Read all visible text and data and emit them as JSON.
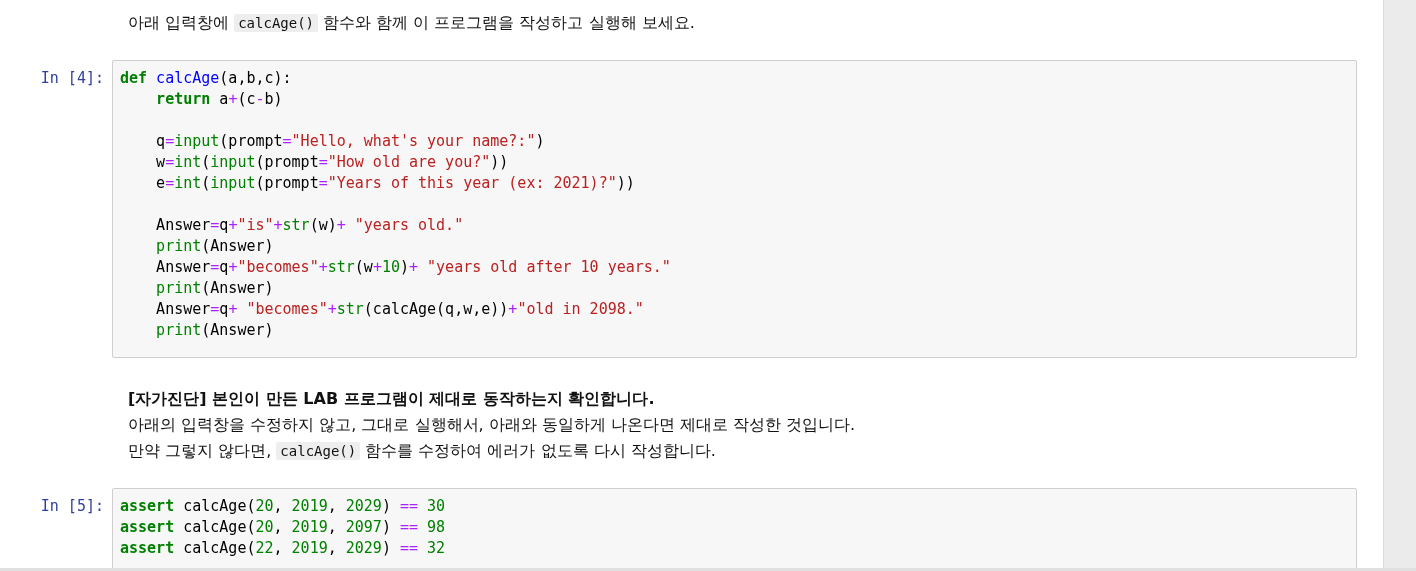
{
  "cells": [
    {
      "kind": "markdown",
      "paragraphs": [
        [
          {
            "kind": "text",
            "text": "아래 입력창에 "
          },
          {
            "kind": "code",
            "text": "calcAge()"
          },
          {
            "kind": "text",
            "text": " 함수와 함께 이 프로그램을 작성하고 실행해 보세요."
          }
        ]
      ]
    },
    {
      "kind": "code",
      "prompt": "In [4]:",
      "blocks": [
        [
          [
            {
              "kind": "kw",
              "text": "def"
            },
            {
              "kind": "fn",
              "text": " calcAge"
            },
            {
              "kind": "plain",
              "text": "(a,b,c):"
            }
          ],
          [
            {
              "kind": "kw",
              "text": "    return"
            },
            {
              "kind": "plain",
              "text": " a"
            },
            {
              "kind": "op",
              "text": "+"
            },
            {
              "kind": "plain",
              "text": "(c"
            },
            {
              "kind": "op",
              "text": "-"
            },
            {
              "kind": "plain",
              "text": "b)"
            }
          ]
        ],
        [
          [
            {
              "kind": "plain",
              "text": "    q"
            },
            {
              "kind": "op",
              "text": "="
            },
            {
              "kind": "builtin",
              "text": "input"
            },
            {
              "kind": "plain",
              "text": "(prompt"
            },
            {
              "kind": "op",
              "text": "="
            },
            {
              "kind": "str",
              "text": "\"Hello, what's your name?:\""
            },
            {
              "kind": "plain",
              "text": ")"
            }
          ],
          [
            {
              "kind": "plain",
              "text": "    w"
            },
            {
              "kind": "op",
              "text": "="
            },
            {
              "kind": "builtin",
              "text": "int"
            },
            {
              "kind": "plain",
              "text": "("
            },
            {
              "kind": "builtin",
              "text": "input"
            },
            {
              "kind": "plain",
              "text": "(prompt"
            },
            {
              "kind": "op",
              "text": "="
            },
            {
              "kind": "str",
              "text": "\"How old are you?\""
            },
            {
              "kind": "plain",
              "text": "))"
            }
          ],
          [
            {
              "kind": "plain",
              "text": "    e"
            },
            {
              "kind": "op",
              "text": "="
            },
            {
              "kind": "builtin",
              "text": "int"
            },
            {
              "kind": "plain",
              "text": "("
            },
            {
              "kind": "builtin",
              "text": "input"
            },
            {
              "kind": "plain",
              "text": "(prompt"
            },
            {
              "kind": "op",
              "text": "="
            },
            {
              "kind": "str",
              "text": "\"Years of this year (ex: 2021)?\""
            },
            {
              "kind": "plain",
              "text": "))"
            }
          ]
        ],
        [
          [
            {
              "kind": "plain",
              "text": "    Answer"
            },
            {
              "kind": "op",
              "text": "="
            },
            {
              "kind": "plain",
              "text": "q"
            },
            {
              "kind": "op",
              "text": "+"
            },
            {
              "kind": "str",
              "text": "\"is\""
            },
            {
              "kind": "op",
              "text": "+"
            },
            {
              "kind": "builtin",
              "text": "str"
            },
            {
              "kind": "plain",
              "text": "(w)"
            },
            {
              "kind": "op",
              "text": "+"
            },
            {
              "kind": "str",
              "text": " \"years old.\""
            }
          ],
          [
            {
              "kind": "builtin",
              "text": "    print"
            },
            {
              "kind": "plain",
              "text": "(Answer)"
            }
          ],
          [
            {
              "kind": "plain",
              "text": "    Answer"
            },
            {
              "kind": "op",
              "text": "="
            },
            {
              "kind": "plain",
              "text": "q"
            },
            {
              "kind": "op",
              "text": "+"
            },
            {
              "kind": "str",
              "text": "\"becomes\""
            },
            {
              "kind": "op",
              "text": "+"
            },
            {
              "kind": "builtin",
              "text": "str"
            },
            {
              "kind": "plain",
              "text": "(w"
            },
            {
              "kind": "op",
              "text": "+"
            },
            {
              "kind": "num",
              "text": "10"
            },
            {
              "kind": "plain",
              "text": ")"
            },
            {
              "kind": "op",
              "text": "+"
            },
            {
              "kind": "str",
              "text": " \"years old after 10 years.\""
            }
          ],
          [
            {
              "kind": "builtin",
              "text": "    print"
            },
            {
              "kind": "plain",
              "text": "(Answer)"
            }
          ],
          [
            {
              "kind": "plain",
              "text": "    Answer"
            },
            {
              "kind": "op",
              "text": "="
            },
            {
              "kind": "plain",
              "text": "q"
            },
            {
              "kind": "op",
              "text": "+"
            },
            {
              "kind": "str",
              "text": " \"becomes\""
            },
            {
              "kind": "op",
              "text": "+"
            },
            {
              "kind": "builtin",
              "text": "str"
            },
            {
              "kind": "plain",
              "text": "(calcAge(q,w,e))"
            },
            {
              "kind": "op",
              "text": "+"
            },
            {
              "kind": "str",
              "text": "\"old in 2098.\""
            }
          ],
          [
            {
              "kind": "builtin",
              "text": "    print"
            },
            {
              "kind": "plain",
              "text": "(Answer)"
            }
          ]
        ]
      ]
    },
    {
      "kind": "markdown",
      "paragraphs": [
        [
          {
            "kind": "text",
            "text": "**[자가진단] 본인이 만든 LAB 프로그램이 제대로 동작하는지 확인합니다.**"
          }
        ],
        [
          {
            "kind": "text",
            "text": "아래의 입력창을 수정하지 않고, 그대로 실행해서, 아래와 동일하게 나온다면 제대로 작성한 것입니다."
          }
        ],
        [
          {
            "kind": "text",
            "text": "만약 그렇지 않다면, "
          },
          {
            "kind": "code",
            "text": "calcAge()"
          },
          {
            "kind": "text",
            "text": " 함수를 수정하여 에러가 없도록 다시 작성합니다."
          }
        ]
      ]
    },
    {
      "kind": "code",
      "prompt": "In [5]:",
      "blocks": [
        [
          [
            {
              "kind": "kw",
              "text": "assert"
            },
            {
              "kind": "plain",
              "text": " calcAge("
            },
            {
              "kind": "num",
              "text": "20"
            },
            {
              "kind": "plain",
              "text": ", "
            },
            {
              "kind": "num",
              "text": "2019"
            },
            {
              "kind": "plain",
              "text": ", "
            },
            {
              "kind": "num",
              "text": "2029"
            },
            {
              "kind": "plain",
              "text": ") "
            },
            {
              "kind": "op",
              "text": "=="
            },
            {
              "kind": "num",
              "text": " 30"
            }
          ],
          [
            {
              "kind": "kw",
              "text": "assert"
            },
            {
              "kind": "plain",
              "text": " calcAge("
            },
            {
              "kind": "num",
              "text": "20"
            },
            {
              "kind": "plain",
              "text": ", "
            },
            {
              "kind": "num",
              "text": "2019"
            },
            {
              "kind": "plain",
              "text": ", "
            },
            {
              "kind": "num",
              "text": "2097"
            },
            {
              "kind": "plain",
              "text": ") "
            },
            {
              "kind": "op",
              "text": "=="
            },
            {
              "kind": "num",
              "text": " 98"
            }
          ],
          [
            {
              "kind": "kw",
              "text": "assert"
            },
            {
              "kind": "plain",
              "text": " calcAge("
            },
            {
              "kind": "num",
              "text": "22"
            },
            {
              "kind": "plain",
              "text": ", "
            },
            {
              "kind": "num",
              "text": "2019"
            },
            {
              "kind": "plain",
              "text": ", "
            },
            {
              "kind": "num",
              "text": "2029"
            },
            {
              "kind": "plain",
              "text": ") "
            },
            {
              "kind": "op",
              "text": "=="
            },
            {
              "kind": "num",
              "text": " 32"
            }
          ]
        ]
      ]
    }
  ]
}
